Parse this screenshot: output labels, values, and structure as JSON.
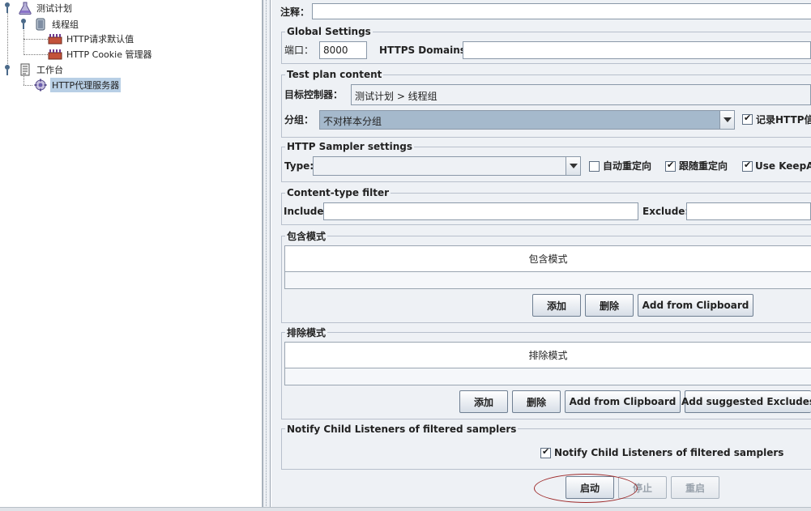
{
  "tree": {
    "items": [
      {
        "label": "测试计划",
        "icon": "flask-icon"
      },
      {
        "label": "线程组",
        "icon": "spool-icon"
      },
      {
        "label": "HTTP请求默认值",
        "icon": "wrench-icon"
      },
      {
        "label": "HTTP Cookie 管理器",
        "icon": "wrench-icon"
      },
      {
        "label": "工作台",
        "icon": "clipboard-icon"
      },
      {
        "label": "HTTP代理服务器",
        "icon": "gear-icon"
      }
    ]
  },
  "comment": {
    "label": "注释：",
    "value": ""
  },
  "global": {
    "title": "Global Settings",
    "port_label": "端口：",
    "port_value": "8000",
    "https_label": "HTTPS Domains :",
    "https_value": ""
  },
  "plan": {
    "title": "Test plan content",
    "target_label": "目标控制器：",
    "target_value": "测试计划 > 线程组",
    "group_label": "分组：",
    "group_value": "不对样本分组",
    "record_label": "记录HTTP信"
  },
  "sampler": {
    "title": "HTTP Sampler settings",
    "type_label": "Type:",
    "type_value": "",
    "redirect_auto_label": "自动重定向",
    "redirect_follow_label": "跟随重定向",
    "keepalive_label": "Use KeepAli"
  },
  "ctype": {
    "title": "Content-type filter",
    "include_label": "Include:",
    "include_value": "",
    "exclude_label": "Exclude:",
    "exclude_value": ""
  },
  "include": {
    "title": "包含模式",
    "column": "包含模式",
    "add": "添加",
    "delete": "删除",
    "clipboard": "Add from Clipboard"
  },
  "exclude": {
    "title": "排除模式",
    "column": "排除模式",
    "add": "添加",
    "delete": "删除",
    "clipboard": "Add from Clipboard",
    "suggested": "Add suggested Excludes"
  },
  "notify": {
    "title": "Notify Child Listeners of filtered samplers",
    "checkbox_label": "Notify Child Listeners of filtered samplers"
  },
  "actions": {
    "start": "启动",
    "stop": "停止",
    "restart": "重启"
  },
  "colors": {
    "annotation_ellipse": "#9e2a2a",
    "selection": "#b8cfe5",
    "panel_bg": "#eef1f5"
  }
}
